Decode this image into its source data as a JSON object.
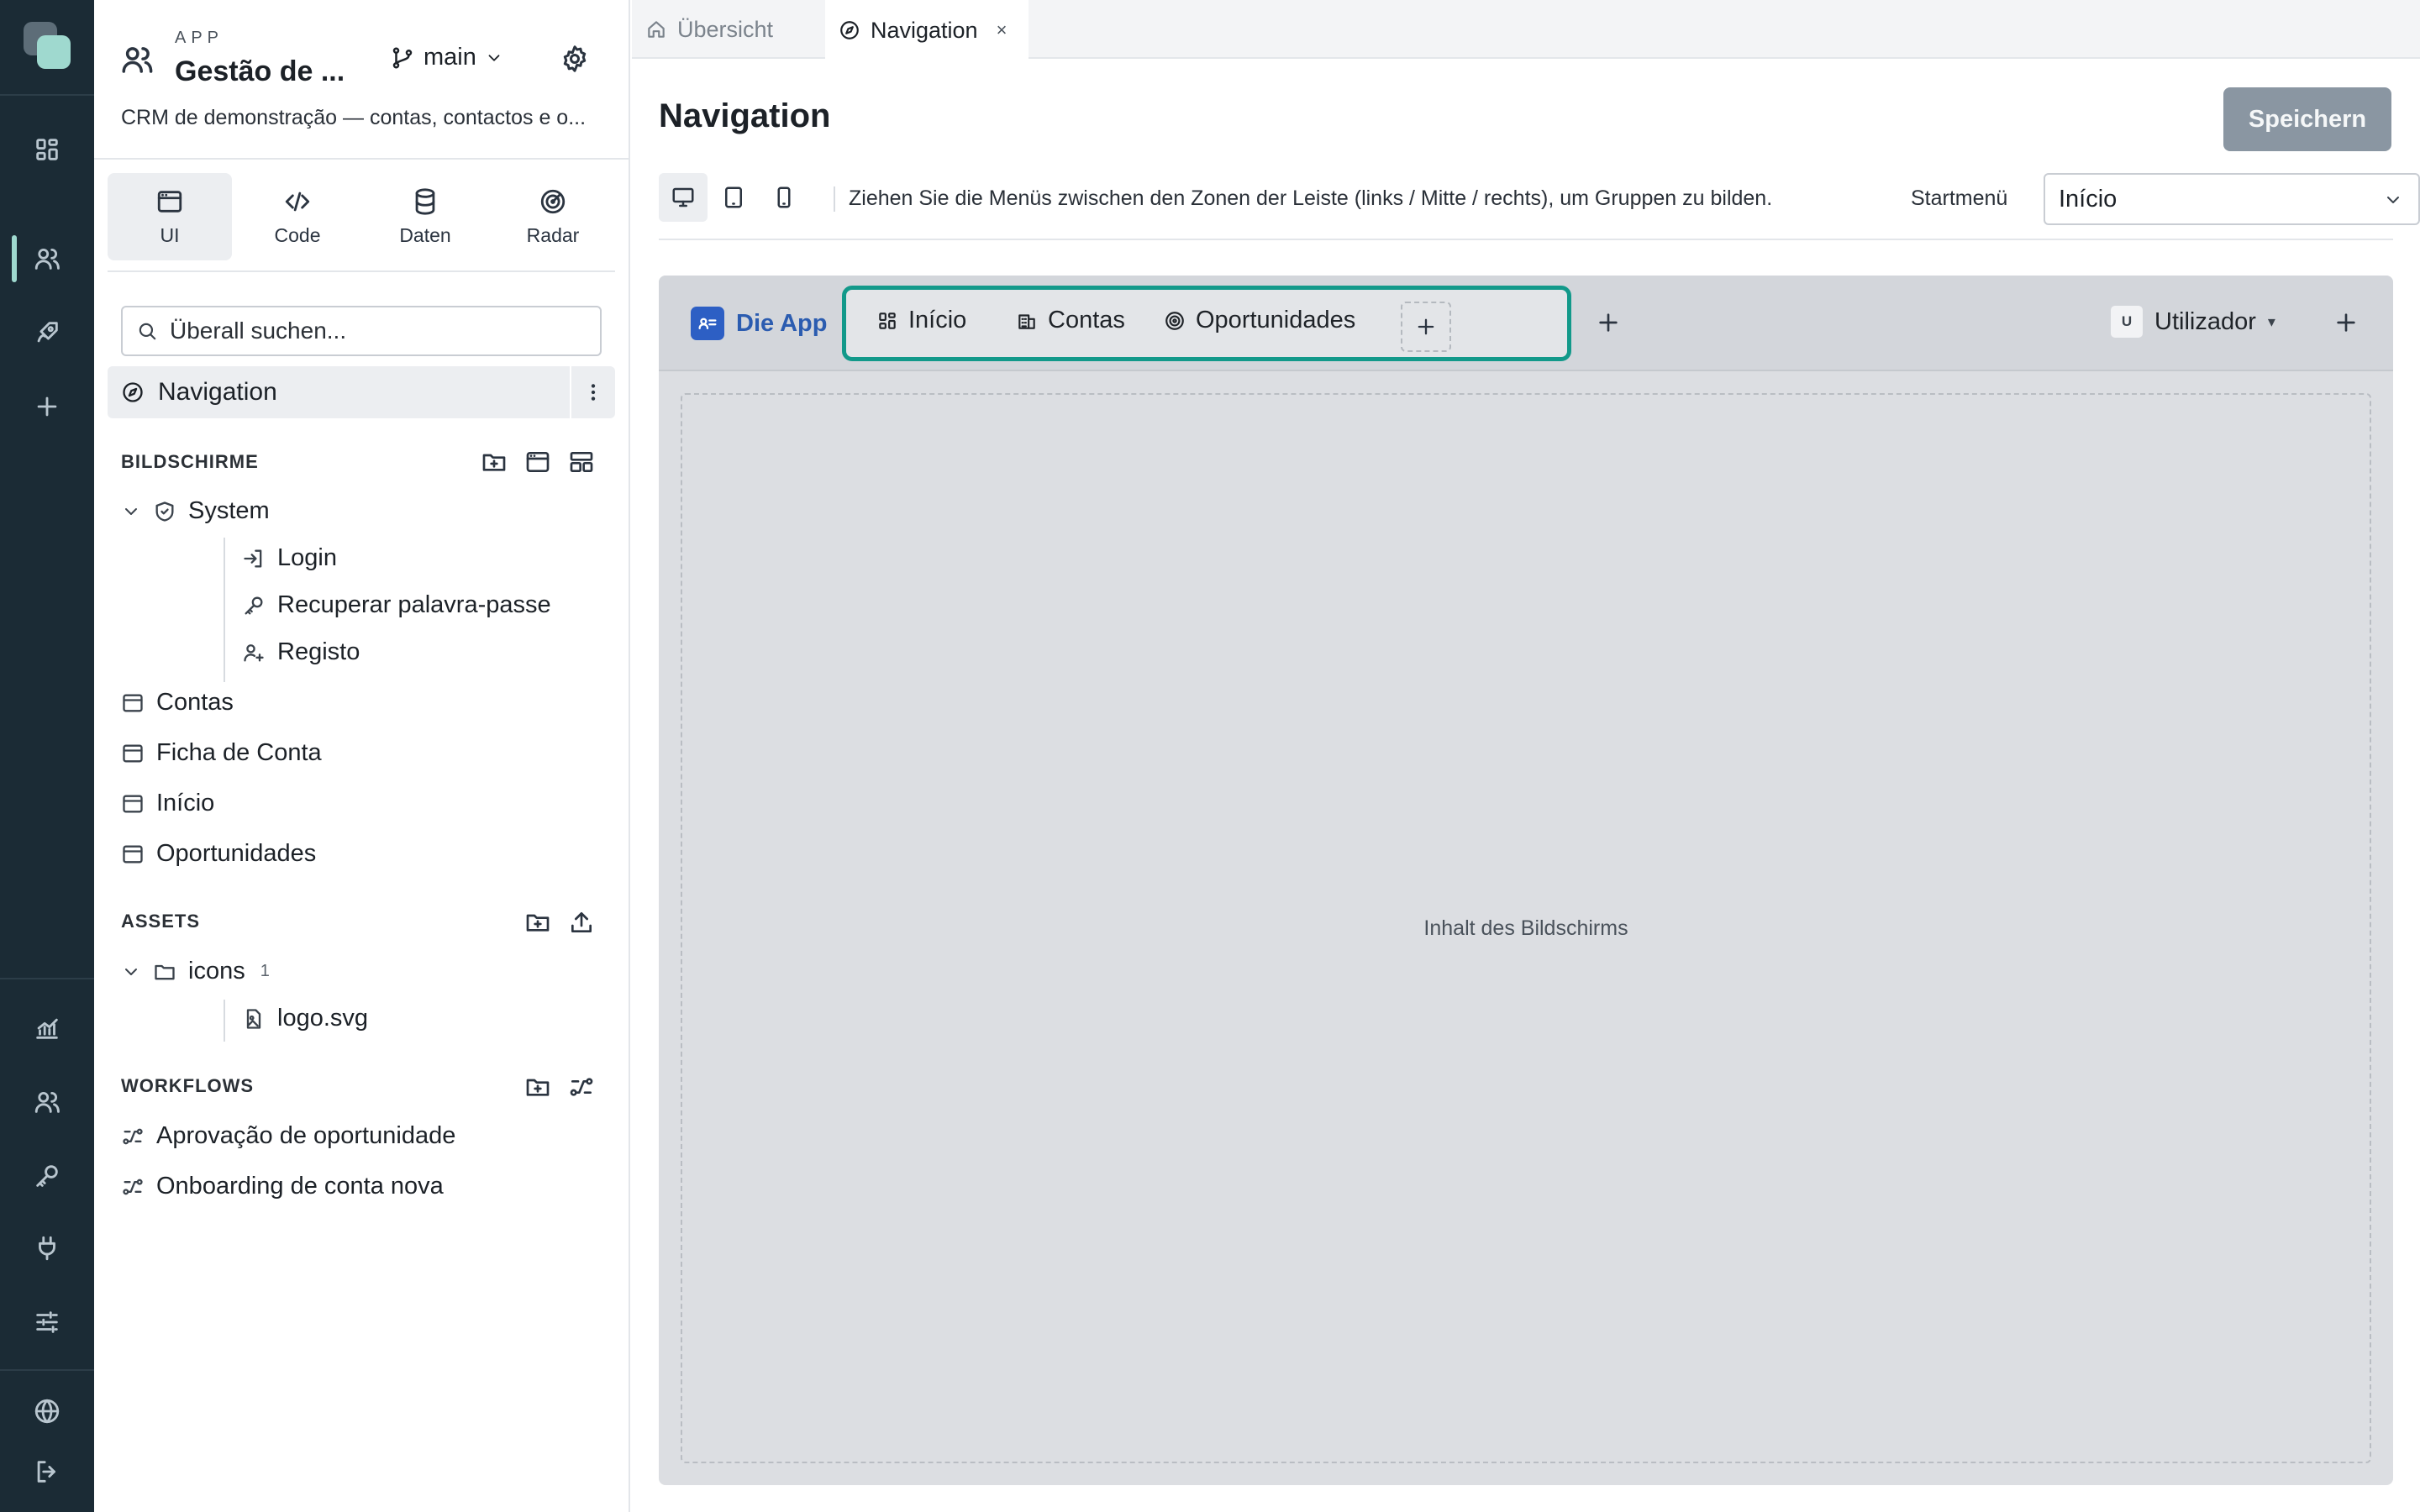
{
  "rail": {
    "icons": [
      "dashboard-icon",
      "people-icon",
      "rocket-icon",
      "plus-icon",
      "chart-icon",
      "users-icon",
      "key-icon",
      "plug-icon",
      "sliders-icon",
      "globe-icon",
      "logout-icon"
    ]
  },
  "app": {
    "kicker": "APP",
    "title": "Gestão de ...",
    "branch": "main",
    "description": "CRM de demonstração — contas, contactos e o..."
  },
  "modes": [
    {
      "label": "UI",
      "icon": "window-icon"
    },
    {
      "label": "Code",
      "icon": "code-icon"
    },
    {
      "label": "Daten",
      "icon": "database-icon"
    },
    {
      "label": "Radar",
      "icon": "radar-icon"
    }
  ],
  "search": {
    "placeholder": "Überall suchen..."
  },
  "nav_item": {
    "label": "Navigation"
  },
  "screens": {
    "heading": "BILDSCHIRME",
    "group": "System",
    "children": [
      "Login",
      "Recuperar palavra-passe",
      "Registo"
    ],
    "items": [
      "Contas",
      "Ficha de Conta",
      "Início",
      "Oportunidades"
    ]
  },
  "assets": {
    "heading": "ASSETS",
    "folder": "icons",
    "folder_count": "1",
    "files": [
      "logo.svg"
    ]
  },
  "workflows": {
    "heading": "WORKFLOWS",
    "items": [
      "Aprovação de oportunidade",
      "Onboarding de conta nova"
    ]
  },
  "tabs": [
    {
      "label": "Übersicht",
      "icon": "home-icon"
    },
    {
      "label": "Navigation",
      "icon": "compass-icon",
      "close": "×"
    }
  ],
  "page": {
    "title": "Navigation",
    "save_label": "Speichern",
    "hint": "Ziehen Sie die Menüs zwischen den Zonen der Leiste (links / Mitte / rechts), um Gruppen zu bilden.",
    "start_label": "Startmenü",
    "start_value": "Início"
  },
  "preview": {
    "brand": "Die App",
    "menu": [
      {
        "label": "Início",
        "icon": "grid-icon"
      },
      {
        "label": "Contas",
        "icon": "building-icon"
      },
      {
        "label": "Oportunidades",
        "icon": "target-icon"
      }
    ],
    "user_avatar": "U",
    "user_label": "Utilizador",
    "user_caret": "▾",
    "content_placeholder": "Inhalt des Bildschirms"
  },
  "colors": {
    "rail_bg": "#1b2b35",
    "accent": "#12998a",
    "brand_blue": "#2d5fc4",
    "save_button": "#8a96a2"
  }
}
